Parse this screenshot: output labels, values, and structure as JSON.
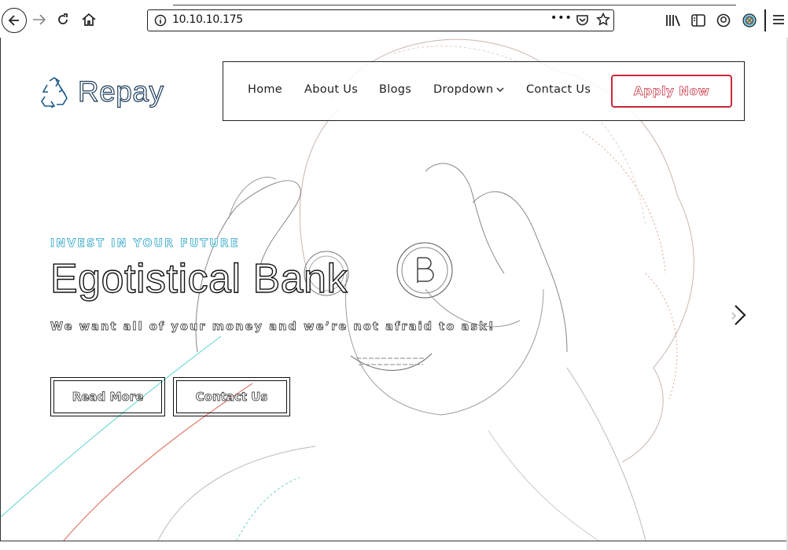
{
  "browser": {
    "url": "10.10.10.175",
    "icons": {
      "back": "back-arrow-icon",
      "forward": "forward-arrow-icon",
      "reload": "reload-icon",
      "home": "home-icon",
      "site_info": "info-icon",
      "page_actions": "more-dots-icon",
      "pocket": "pocket-icon",
      "bookmark": "star-icon",
      "library": "library-icon",
      "reader": "sidebar-icon",
      "account": "account-icon",
      "extension": "extension-icon",
      "menu": "hamburger-icon"
    },
    "page_actions_text": "•••"
  },
  "site": {
    "logo_text": "Repay",
    "logo_icon": "recycle-icon",
    "nav": {
      "home": "Home",
      "about": "About Us",
      "blogs": "Blogs",
      "dropdown": "Dropdown",
      "contact": "Contact Us",
      "apply": "Apply Now"
    },
    "hero": {
      "tagline": "INVEST IN YOUR FUTURE",
      "title": "Egotistical Bank",
      "subtitle": "We want all of your money and we’re not afraid to ask!",
      "read_more": "Read More",
      "contact_us": "Contact Us"
    },
    "colors": {
      "accent_red": "#c8283a",
      "tagline_blue": "#2aa4c8"
    }
  }
}
